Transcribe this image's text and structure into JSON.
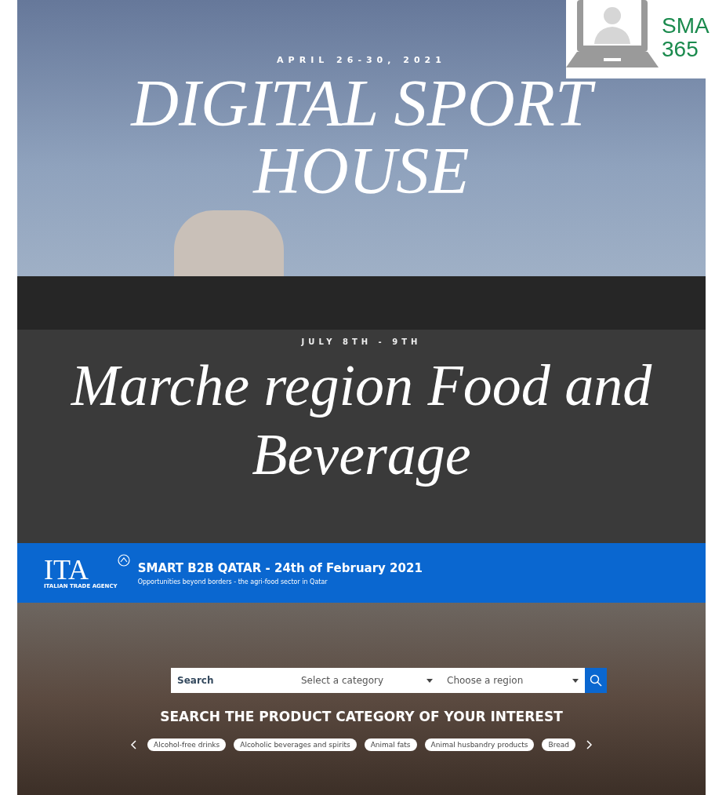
{
  "logo_overlay": {
    "line_1": "SMA",
    "line_2": "365"
  },
  "sport_banner": {
    "date": "APRIL 26-30, 2021",
    "title": "DIGITAL SPORT HOUSE"
  },
  "food_banner": {
    "date": "JULY 8TH - 9TH",
    "title": "Marche region Food and Beverage"
  },
  "ita_header": {
    "logo": "ITA",
    "logo_caption": "ITALIAN TRADE AGENCY",
    "title": "SMART B2B QATAR - 24th of February 2021",
    "subtitle": "Opportunities beyond borders - the agri-food sector in Qatar"
  },
  "search_bar": {
    "search_placeholder": "Search",
    "category_placeholder": "Select a category",
    "region_placeholder": "Choose a region"
  },
  "product_section": {
    "heading": "SEARCH THE PRODUCT CATEGORY OF YOUR INTEREST",
    "categories": [
      {
        "label": "Alcohol-free drinks"
      },
      {
        "label": "Alcoholic beverages and spirits"
      },
      {
        "label": "Animal fats"
      },
      {
        "label": "Animal husbandry products"
      },
      {
        "label": "Bread"
      }
    ]
  }
}
